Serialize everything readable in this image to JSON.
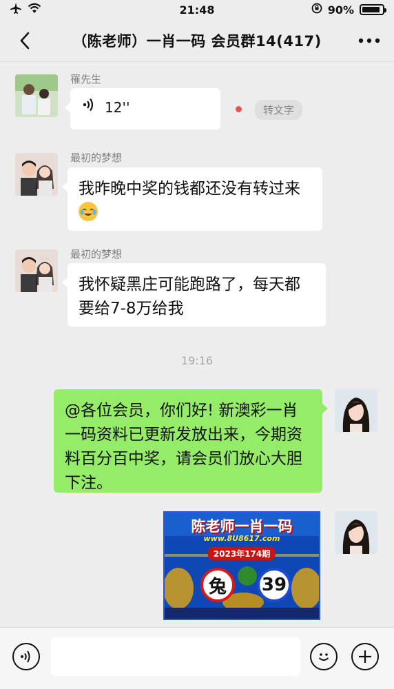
{
  "status_bar": {
    "time": "21:48",
    "battery_text": "90%",
    "battery_level": 0.9
  },
  "nav": {
    "title": "（陈老师）一肖一码 会员群14(417)"
  },
  "messages": [
    {
      "type": "voice",
      "sender": "罹先生",
      "duration": "12''",
      "transcribe_label": "转文字"
    },
    {
      "type": "text",
      "sender": "最初的梦想",
      "text": "我昨晚中奖的钱都还没有转过来"
    },
    {
      "type": "text",
      "sender": "最初的梦想",
      "text": "我怀疑黑庄可能跑路了，每天都要给7-8万给我"
    },
    {
      "type": "timestamp",
      "text": "19:16"
    },
    {
      "type": "text",
      "sender": "self",
      "text": "@各位会员，你们好! 新澳彩一肖一码资料已更新发放出来，今期资料百分百中奖，请会员们放心大胆下注。"
    },
    {
      "type": "image",
      "sender": "self",
      "image_title": "陈老师一肖一码",
      "image_url_text": "www.8U8617.com",
      "image_issue": "2023年174期",
      "image_zodiac": "兔",
      "image_number": "39"
    }
  ],
  "input_bar": {
    "placeholder": ""
  },
  "colors": {
    "background": "#ededed",
    "self_bubble": "#95ec69",
    "other_bubble": "#ffffff",
    "unread_dot": "#f05151"
  }
}
